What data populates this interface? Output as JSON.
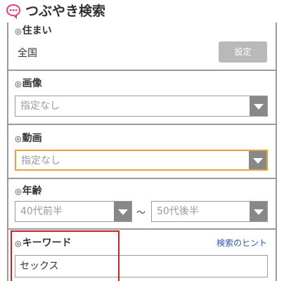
{
  "header": {
    "title": "つぶやき検索",
    "icon": "speech-bubble-icon",
    "accent_color": "#e0407a"
  },
  "residence": {
    "label": "住まい",
    "value": "全国",
    "button_label": "設定"
  },
  "image": {
    "label": "画像",
    "selected": "指定なし"
  },
  "video": {
    "label": "動画",
    "selected": "指定なし"
  },
  "age": {
    "label": "年齢",
    "from": "40代前半",
    "separator": "〜",
    "to": "50代後半"
  },
  "keyword": {
    "label": "キーワード",
    "hint_link": "検索のヒント",
    "value": "セックス"
  },
  "label_mark": "◎",
  "colors": {
    "focus_border": "#e5a43a",
    "highlight_border": "#cc1f1f",
    "link": "#3355aa",
    "button_bg": "#b9b9b9"
  }
}
